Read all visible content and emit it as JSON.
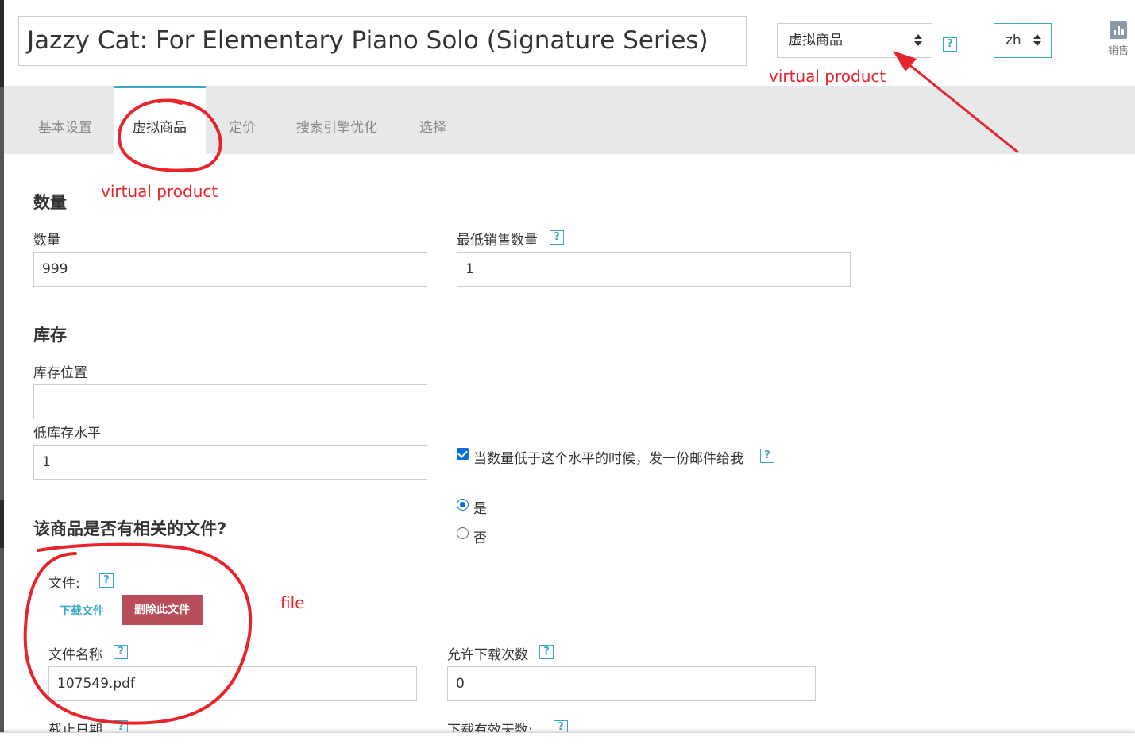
{
  "product_name": "Jazzy Cat: For Elementary Piano Solo (Signature Series)",
  "product_type_select": {
    "value": "虚拟商品"
  },
  "language_select": {
    "value": "zh"
  },
  "help_glyph": "?",
  "toolbar": {
    "sales_label": "销售"
  },
  "tabs": [
    {
      "label": "基本设置",
      "active": false
    },
    {
      "label": "虚拟商品",
      "active": true
    },
    {
      "label": "定价",
      "active": false
    },
    {
      "label": "搜索引擎优化",
      "active": false
    },
    {
      "label": "选择",
      "active": false
    }
  ],
  "quantity_section": {
    "heading": "数量",
    "quantity_label": "数量",
    "quantity_value": "999",
    "min_sale_label": "最低销售数量",
    "min_sale_value": "1"
  },
  "stock_section": {
    "heading": "库存",
    "location_label": "库存位置",
    "location_value": "",
    "low_stock_label": "低库存水平",
    "low_stock_value": "1",
    "email_alert_label": "当数量低于这个水平的时候，发一份邮件给我",
    "email_alert_checked": true
  },
  "files_section": {
    "heading": "该商品是否有相关的文件?",
    "yes_label": "是",
    "no_label": "否",
    "selected": "yes",
    "file_label": "文件:",
    "download_button": "下载文件",
    "delete_button": "删除此文件",
    "filename_label": "文件名称",
    "filename_value": "107549.pdf",
    "download_count_label": "允许下载次数",
    "download_count_value": "0",
    "expiry_label": "截止日期",
    "valid_days_label": "下载有效天数:"
  },
  "annotations": {
    "select_note": "virtual product",
    "tab_note": "virtual product",
    "file_note": "file"
  },
  "colors": {
    "accent": "#3aa8c4",
    "danger": "#b94e5a",
    "annotation": "#e8232b",
    "checkbox": "#0a6fd8",
    "tabbar": "#e6e8ea"
  }
}
